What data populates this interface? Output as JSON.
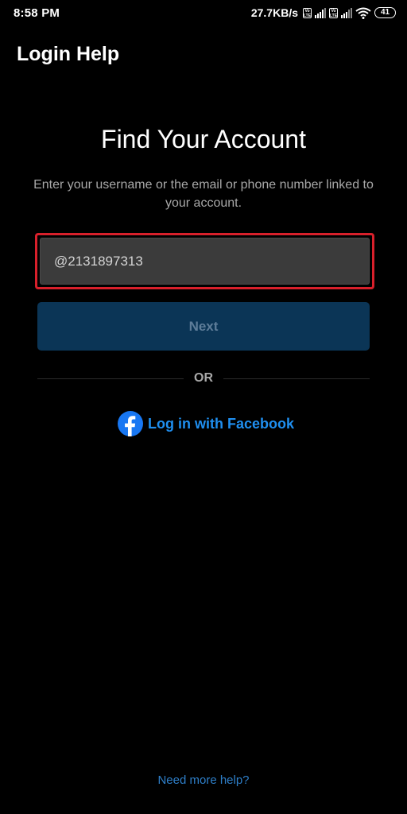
{
  "status_bar": {
    "time": "8:58 PM",
    "net_speed": "27.7KB/s",
    "volte_label": "Vo LTE",
    "battery": "41",
    "icons": [
      "volte-icon",
      "signal-icon",
      "volte-icon",
      "signal-icon",
      "wifi-icon",
      "battery-icon"
    ]
  },
  "header": {
    "title": "Login Help"
  },
  "main": {
    "heading": "Find Your Account",
    "subtitle": "Enter your username or the email or phone number linked to your account.",
    "input": {
      "value": "@2131897313",
      "highlight_color": "#d8202b"
    },
    "next_label": "Next",
    "or_label": "OR",
    "facebook_label": "Log in with Facebook"
  },
  "footer": {
    "help_link": "Need more help?"
  },
  "colors": {
    "background": "#000000",
    "button": "#0b3556",
    "facebook": "#1877f2",
    "link": "#2e7fc9"
  }
}
